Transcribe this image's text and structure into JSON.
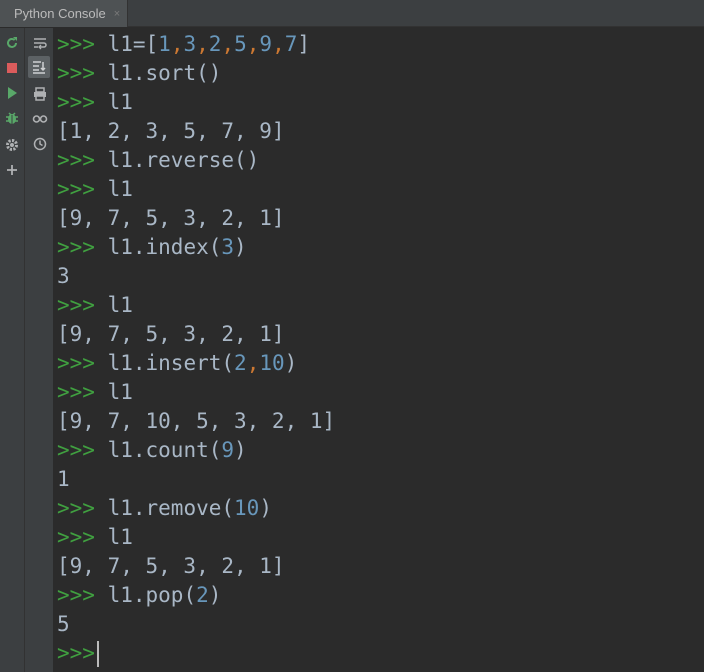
{
  "tab": {
    "title": "Python Console",
    "close": "×"
  },
  "toolbar": {
    "left": [
      "rerun-icon",
      "stop-icon",
      "run-icon",
      "debug-icon",
      "settings-icon",
      "add-icon"
    ],
    "right": [
      "soft-wrap-icon",
      "scroll-to-end-icon",
      "print-icon",
      "variables-icon",
      "history-icon"
    ]
  },
  "console": {
    "prompt": ">>>",
    "lines": [
      {
        "kind": "input",
        "tokens": [
          {
            "t": "l1=[",
            "c": "text"
          },
          {
            "t": "1",
            "c": "num"
          },
          {
            "t": ",",
            "c": "comma"
          },
          {
            "t": "3",
            "c": "num"
          },
          {
            "t": ",",
            "c": "comma"
          },
          {
            "t": "2",
            "c": "num"
          },
          {
            "t": ",",
            "c": "comma"
          },
          {
            "t": "5",
            "c": "num"
          },
          {
            "t": ",",
            "c": "comma"
          },
          {
            "t": "9",
            "c": "num"
          },
          {
            "t": ",",
            "c": "comma"
          },
          {
            "t": "7",
            "c": "num"
          },
          {
            "t": "]",
            "c": "text"
          }
        ]
      },
      {
        "kind": "input",
        "tokens": [
          {
            "t": "l1.sort()",
            "c": "text"
          }
        ]
      },
      {
        "kind": "input",
        "tokens": [
          {
            "t": "l1",
            "c": "text"
          }
        ]
      },
      {
        "kind": "output",
        "text": "[1, 2, 3, 5, 7, 9]"
      },
      {
        "kind": "input",
        "tokens": [
          {
            "t": "l1.reverse()",
            "c": "text"
          }
        ]
      },
      {
        "kind": "input",
        "tokens": [
          {
            "t": "l1",
            "c": "text"
          }
        ]
      },
      {
        "kind": "output",
        "text": "[9, 7, 5, 3, 2, 1]"
      },
      {
        "kind": "input",
        "tokens": [
          {
            "t": "l1.index(",
            "c": "text"
          },
          {
            "t": "3",
            "c": "num"
          },
          {
            "t": ")",
            "c": "text"
          }
        ]
      },
      {
        "kind": "output",
        "text": "3"
      },
      {
        "kind": "input",
        "tokens": [
          {
            "t": "l1",
            "c": "text"
          }
        ]
      },
      {
        "kind": "output",
        "text": "[9, 7, 5, 3, 2, 1]"
      },
      {
        "kind": "input",
        "tokens": [
          {
            "t": "l1.insert(",
            "c": "text"
          },
          {
            "t": "2",
            "c": "num"
          },
          {
            "t": ",",
            "c": "comma"
          },
          {
            "t": "10",
            "c": "num"
          },
          {
            "t": ")",
            "c": "text"
          }
        ]
      },
      {
        "kind": "input",
        "tokens": [
          {
            "t": "l1",
            "c": "text"
          }
        ]
      },
      {
        "kind": "output",
        "text": "[9, 7, 10, 5, 3, 2, 1]"
      },
      {
        "kind": "input",
        "tokens": [
          {
            "t": "l1.count(",
            "c": "text"
          },
          {
            "t": "9",
            "c": "num"
          },
          {
            "t": ")",
            "c": "text"
          }
        ]
      },
      {
        "kind": "output",
        "text": "1"
      },
      {
        "kind": "input",
        "tokens": [
          {
            "t": "l1.remove(",
            "c": "text"
          },
          {
            "t": "10",
            "c": "num"
          },
          {
            "t": ")",
            "c": "text"
          }
        ]
      },
      {
        "kind": "input",
        "tokens": [
          {
            "t": "l1",
            "c": "text"
          }
        ]
      },
      {
        "kind": "output",
        "text": "[9, 7, 5, 3, 2, 1]"
      },
      {
        "kind": "input",
        "tokens": [
          {
            "t": "l1.pop(",
            "c": "text"
          },
          {
            "t": "2",
            "c": "num"
          },
          {
            "t": ")",
            "c": "text"
          }
        ]
      },
      {
        "kind": "output",
        "text": "5"
      },
      {
        "kind": "active-input",
        "tokens": []
      }
    ]
  }
}
